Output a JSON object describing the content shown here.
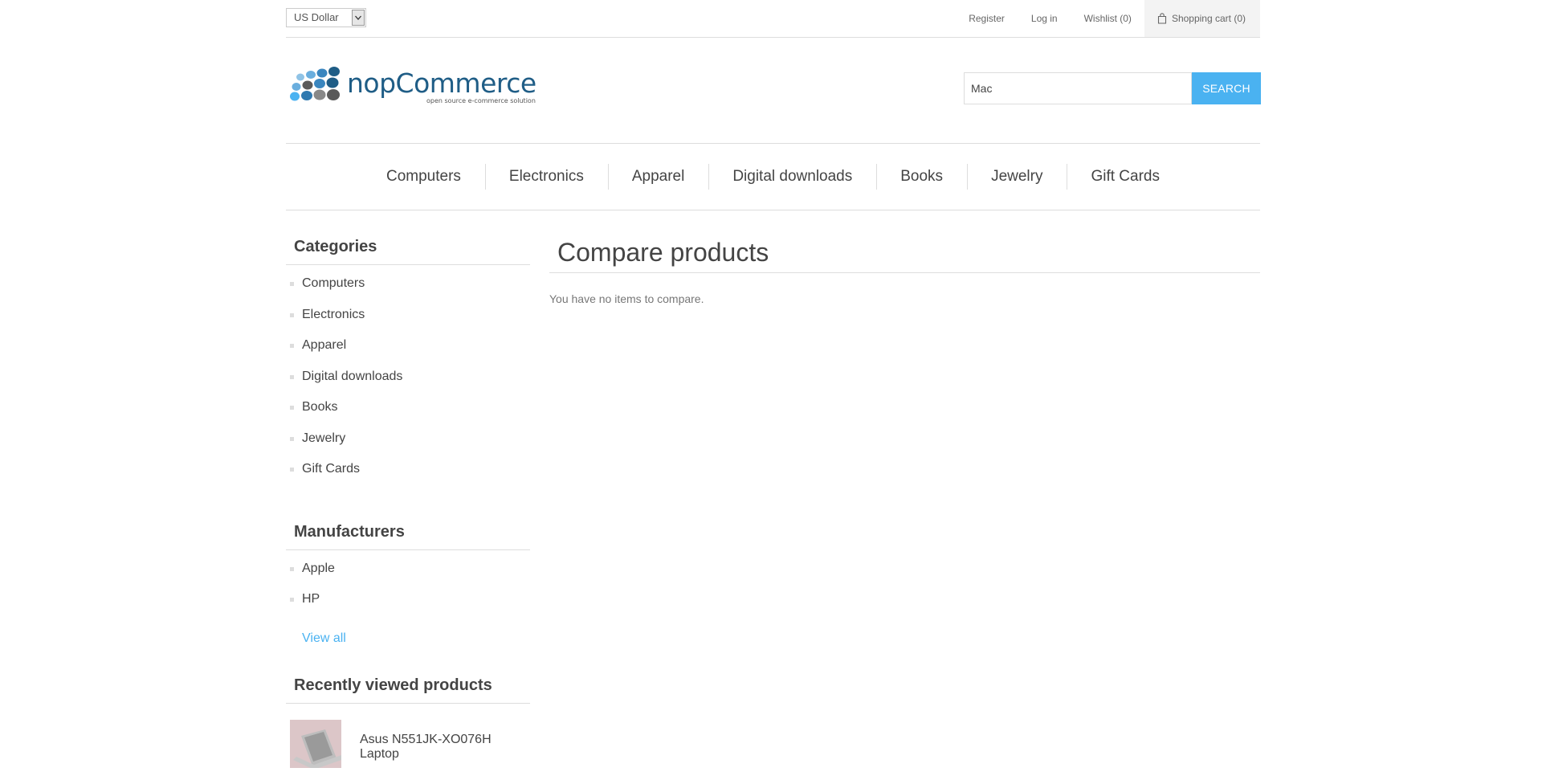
{
  "header": {
    "currency": {
      "selected": "US Dollar"
    },
    "links": {
      "register": "Register",
      "login": "Log in",
      "wishlist": "Wishlist (0)",
      "cart": "Shopping cart (0)"
    }
  },
  "logo": {
    "name": "nopCommerce",
    "tagline": "open source e-commerce solution"
  },
  "search": {
    "value": "Mac",
    "button": "SEARCH"
  },
  "top_menu": [
    {
      "label": "Computers"
    },
    {
      "label": "Electronics"
    },
    {
      "label": "Apparel"
    },
    {
      "label": "Digital downloads"
    },
    {
      "label": "Books"
    },
    {
      "label": "Jewelry"
    },
    {
      "label": "Gift Cards"
    }
  ],
  "sidebar": {
    "categories": {
      "title": "Categories",
      "items": [
        {
          "label": "Computers"
        },
        {
          "label": "Electronics"
        },
        {
          "label": "Apparel"
        },
        {
          "label": "Digital downloads"
        },
        {
          "label": "Books"
        },
        {
          "label": "Jewelry"
        },
        {
          "label": "Gift Cards"
        }
      ]
    },
    "manufacturers": {
      "title": "Manufacturers",
      "items": [
        {
          "label": "Apple"
        },
        {
          "label": "HP"
        }
      ],
      "view_all": "View all"
    },
    "recently_viewed": {
      "title": "Recently viewed products",
      "items": [
        {
          "name": "Asus N551JK-XO076H Laptop"
        }
      ]
    }
  },
  "main": {
    "title": "Compare products",
    "message": "You have no items to compare."
  },
  "colors": {
    "accent": "#4ab2f1",
    "text": "#444444",
    "border": "#dddddd",
    "logo_dark": "#1f5d86"
  }
}
